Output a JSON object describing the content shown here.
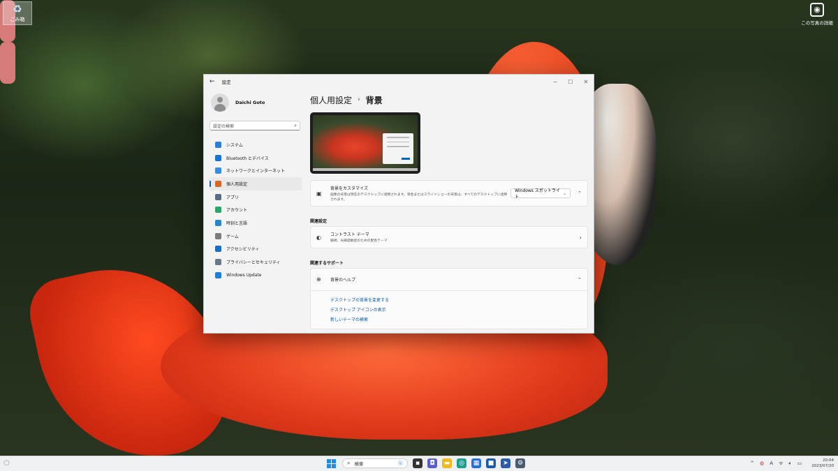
{
  "desktop": {
    "recycle_bin_label": "ごみ箱",
    "photo_info_label": "この写真の詳細"
  },
  "window": {
    "title": "設定",
    "controls": {
      "minimize": "─",
      "maximize": "☐",
      "close": "✕"
    }
  },
  "user": {
    "name": "Daichi Goto"
  },
  "search": {
    "placeholder": "設定の検索"
  },
  "nav": {
    "items": [
      {
        "label": "システム",
        "icon": "system-icon",
        "color": "#2b7fd6"
      },
      {
        "label": "Bluetooth とデバイス",
        "icon": "bluetooth-icon",
        "color": "#1a73d1"
      },
      {
        "label": "ネットワークとインターネット",
        "icon": "network-icon",
        "color": "#3a8ddc"
      },
      {
        "label": "個人用設定",
        "icon": "brush-icon",
        "color": "#d46a2a",
        "active": true
      },
      {
        "label": "アプリ",
        "icon": "apps-icon",
        "color": "#5a6a80"
      },
      {
        "label": "アカウント",
        "icon": "account-icon",
        "color": "#2ea36b"
      },
      {
        "label": "時刻と言語",
        "icon": "globe-clock-icon",
        "color": "#2a86c8"
      },
      {
        "label": "ゲーム",
        "icon": "game-icon",
        "color": "#7b7b7b"
      },
      {
        "label": "アクセシビリティ",
        "icon": "accessibility-icon",
        "color": "#1b6fc2"
      },
      {
        "label": "プライバシーとセキュリティ",
        "icon": "shield-icon",
        "color": "#6b7a8a"
      },
      {
        "label": "Windows Update",
        "icon": "update-icon",
        "color": "#1f7fd4"
      }
    ]
  },
  "breadcrumb": {
    "parent": "個人用設定",
    "separator": "›",
    "current": "背景"
  },
  "background_card": {
    "title": "背景をカスタマイズ",
    "description": "画像の背景は現在のデスクトップに適用されます。単色またはスライドショーの背景は、すべてのデスクトップに適用されます。",
    "selected": "Windows スポットライト"
  },
  "related_settings": {
    "heading": "関連設定",
    "contrast_title": "コントラスト テーマ",
    "contrast_desc": "弱視、光線過敏症のための配色テーマ"
  },
  "related_support": {
    "heading": "関連するサポート",
    "help_title": "背景のヘルプ",
    "links": [
      "デスクトップの背景を変更する",
      "デスクトップ アイコンの表示",
      "新しいテーマの検索"
    ]
  },
  "taskbar": {
    "search_label": "検索",
    "time": "20:04",
    "date": "2023/07/20"
  }
}
